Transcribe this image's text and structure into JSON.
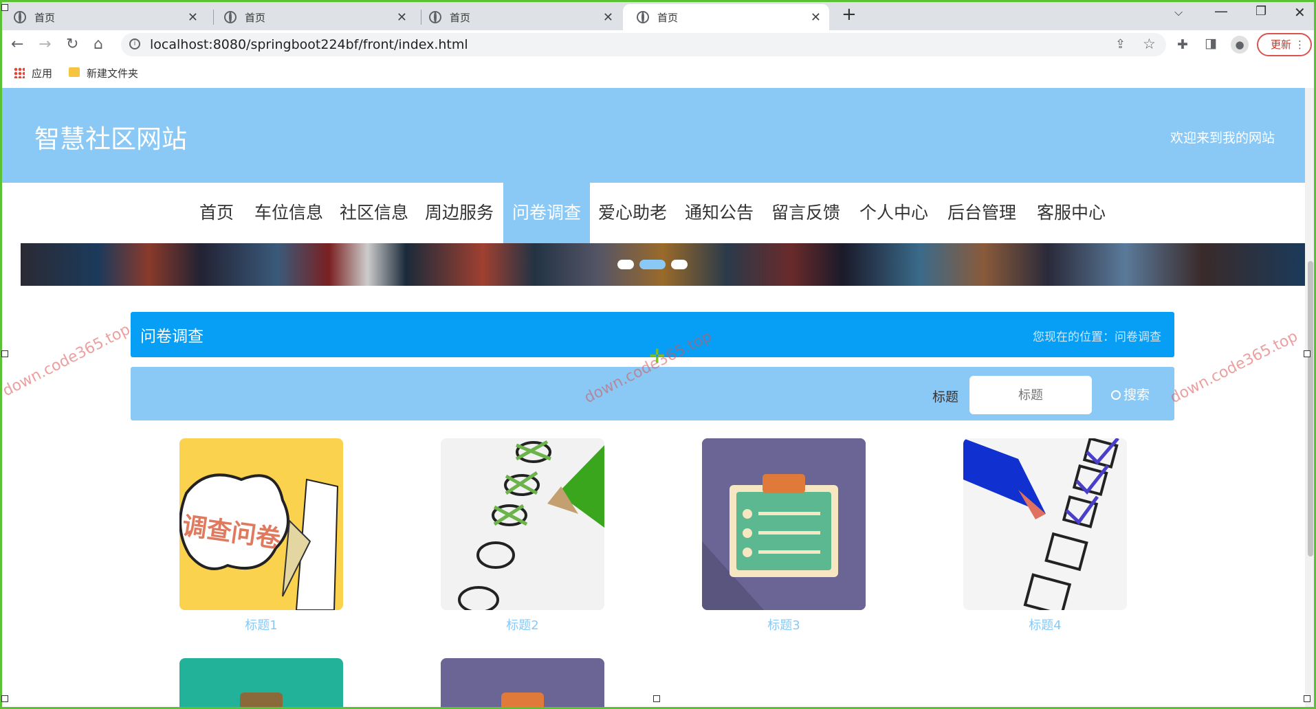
{
  "browser": {
    "tabs": [
      {
        "label": "首页"
      },
      {
        "label": "首页"
      },
      {
        "label": "首页"
      },
      {
        "label": "首页"
      }
    ],
    "new_tab": "+",
    "url": "localhost:8080/springboot224bf/front/index.html",
    "update_label": "更新",
    "bookmarks": [
      {
        "label": "应用"
      },
      {
        "label": "新建文件夹"
      }
    ]
  },
  "site": {
    "title": "智慧社区网站",
    "welcome": "欢迎来到我的网站"
  },
  "nav": {
    "items": [
      {
        "label": "首页"
      },
      {
        "label": "车位信息"
      },
      {
        "label": "社区信息"
      },
      {
        "label": "周边服务"
      },
      {
        "label": "问卷调查",
        "active": true
      },
      {
        "label": "爱心助老"
      },
      {
        "label": "通知公告"
      },
      {
        "label": "留言反馈"
      },
      {
        "label": "个人中心"
      },
      {
        "label": "后台管理"
      },
      {
        "label": "客服中心"
      }
    ]
  },
  "banner": {
    "dots": 3,
    "active_dot": 1
  },
  "section": {
    "title": "问卷调查",
    "breadcrumb": "您现在的位置：问卷调查"
  },
  "search": {
    "label": "标题",
    "placeholder": "标题",
    "button": "搜索"
  },
  "cards": [
    {
      "caption": "标题1",
      "image": "调查问卷"
    },
    {
      "caption": "标题2"
    },
    {
      "caption": "标题3"
    },
    {
      "caption": "标题4"
    }
  ],
  "watermark": "down.code365.top",
  "colors": {
    "header": "#8ac9f5",
    "section_bar": "#069ff5",
    "caption": "#8ac9f5"
  }
}
